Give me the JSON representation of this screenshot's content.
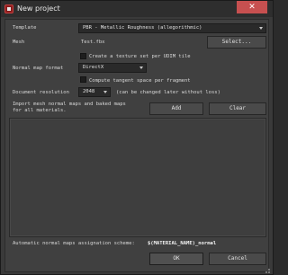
{
  "window": {
    "title": "New project",
    "close_label": "✕"
  },
  "template": {
    "label": "Template",
    "value": "PBR - Metallic Roughness (allegorithmic)"
  },
  "mesh": {
    "label": "Mesh",
    "value": "Test.fbx",
    "select_label": "Select..."
  },
  "udim": {
    "label": "Create a texture set per UDIM tile",
    "checked": false
  },
  "normal_map_format": {
    "label": "Normal map format",
    "value": "DirectX"
  },
  "tangent": {
    "label": "Compute tangent space per fragment",
    "checked": false
  },
  "resolution": {
    "label": "Document resolution",
    "value": "2048",
    "note": "(can be changed later without loss)"
  },
  "import": {
    "label_line1": "Import mesh normal maps and baked maps",
    "label_line2": "for all materials.",
    "add_label": "Add",
    "clear_label": "Clear"
  },
  "assignment": {
    "label": "Automatic normal maps assignation scheme:",
    "value": "$(MATERIAL_NAME)_normal"
  },
  "footer": {
    "ok_label": "OK",
    "cancel_label": "Cancel"
  },
  "colors": {
    "window_bg": "#3a3a3a",
    "field_bg": "#2a2a2a",
    "close_red": "#c75050"
  }
}
